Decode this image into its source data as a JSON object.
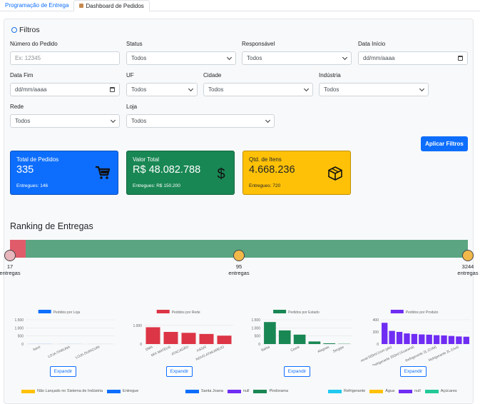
{
  "tabs": [
    {
      "label": "Programação de Entrega",
      "active": false
    },
    {
      "label": "Dashboard de Pedidos",
      "active": true
    }
  ],
  "filters": {
    "title": "Filtros",
    "numero": {
      "label": "Número do Pedido",
      "placeholder": "Ex: 12345"
    },
    "status": {
      "label": "Status",
      "value": "Todos"
    },
    "responsavel": {
      "label": "Responsável",
      "value": "Todos"
    },
    "data_inicio": {
      "label": "Data Início",
      "value": "dd/mm/aaaa"
    },
    "data_fim": {
      "label": "Data Fim",
      "value": "dd/mm/aaaa"
    },
    "uf": {
      "label": "UF",
      "value": "Todos"
    },
    "cidade": {
      "label": "Cidade",
      "value": "Todos"
    },
    "industria": {
      "label": "Indústria",
      "value": "Todos"
    },
    "rede": {
      "label": "Rede",
      "value": "Todos"
    },
    "loja": {
      "label": "Loja",
      "value": "Todos"
    },
    "apply_label": "Aplicar Filtros"
  },
  "cards": [
    {
      "title": "Total de Pedidos",
      "value": "335",
      "sub": "Entregues: 146",
      "color": "#0d6efd",
      "text": "#ffffff",
      "icon": "cart-icon"
    },
    {
      "title": "Valor Total",
      "value": "R$ 48.082.788",
      "sub": "Entregues: R$ 150.200",
      "color": "#198754",
      "text": "#ffffff",
      "icon": "dollar-icon"
    },
    {
      "title": "Qtd. de Itens",
      "value": "4.668.236",
      "sub": "Entregues: 720",
      "color": "#ffc107",
      "text": "#212529",
      "icon": "box-icon"
    }
  ],
  "ranking": {
    "title": "Ranking de Entregas",
    "items": [
      {
        "count": "17",
        "label": "entregas"
      },
      {
        "count": "95",
        "label": "entregas"
      },
      {
        "count": "3244",
        "label": "entregas"
      }
    ],
    "colors": {
      "low": "#e05c6b",
      "high": "#5ba582"
    }
  },
  "expand_label": "Expandir",
  "chart_data": [
    {
      "type": "bar",
      "title": "Pedidos por Loja",
      "color": "#0d6efd",
      "categories": [
        "Itanó",
        "LOJA ITABUNA",
        "LOJA OURICURI"
      ],
      "values": [
        5,
        3,
        2
      ],
      "yticks": [
        "1.500",
        "1.000",
        "500",
        "0"
      ],
      "ylim": [
        0,
        1500
      ]
    },
    {
      "type": "bar",
      "title": "Pedidos por Rede",
      "color": "#dc3545",
      "categories": [
        "DMA",
        "MIX MATEUS",
        "ATACADÃO",
        "ASSAÍ",
        "NOVO ATAKAREJO"
      ],
      "values": [
        900,
        650,
        600,
        540,
        450
      ],
      "yticks": [
        "1.000",
        "0"
      ],
      "ylim": [
        0,
        1300
      ]
    },
    {
      "type": "bar",
      "title": "Pedidos por Estado",
      "color": "#198754",
      "categories": [
        "Bahia",
        "Ceará",
        "Alagoas",
        "Sergipe"
      ],
      "values": [
        1450,
        900,
        620,
        170,
        50,
        15
      ],
      "labels": [
        "Bahia",
        "",
        "Ceará",
        "",
        "Alagoas",
        "Sergipe"
      ],
      "yticks": [
        "1.500",
        "1.000",
        "500",
        "0"
      ],
      "ylim": [
        0,
        1600
      ]
    },
    {
      "type": "bar",
      "title": "Pedidos por Produto",
      "color": "#6f2cf3",
      "categories": [
        "Água Mineral 500ml (com gás)",
        "Refrigerante 250ml (Guaraná)",
        "Refrigerante 2L (Cola)",
        "Refrigerante 2L (Uva)"
      ],
      "values": [
        420,
        260,
        240,
        210,
        200,
        190,
        185,
        175,
        170,
        160,
        150,
        145
      ],
      "yticks": [
        "400",
        "200",
        "0"
      ],
      "ylim": [
        0,
        480
      ]
    }
  ],
  "bottom_legends": [
    {
      "label": "Não Lançado no Sistema de Indústria",
      "color": "#ffc107"
    },
    {
      "label": "Entregue",
      "color": "#0d6efd"
    },
    {
      "label": "Santa Joana",
      "color": "#0d6efd"
    },
    {
      "label": "null",
      "color": "#6f2cf3"
    },
    {
      "label": "Pindorama",
      "color": "#198754"
    },
    {
      "label": "Refrigerante",
      "color": "#20c9f0"
    },
    {
      "label": "Água",
      "color": "#ffc107"
    },
    {
      "label": "null",
      "color": "#6f2cf3"
    },
    {
      "label": "Açúcares",
      "color": "#20c997"
    }
  ]
}
